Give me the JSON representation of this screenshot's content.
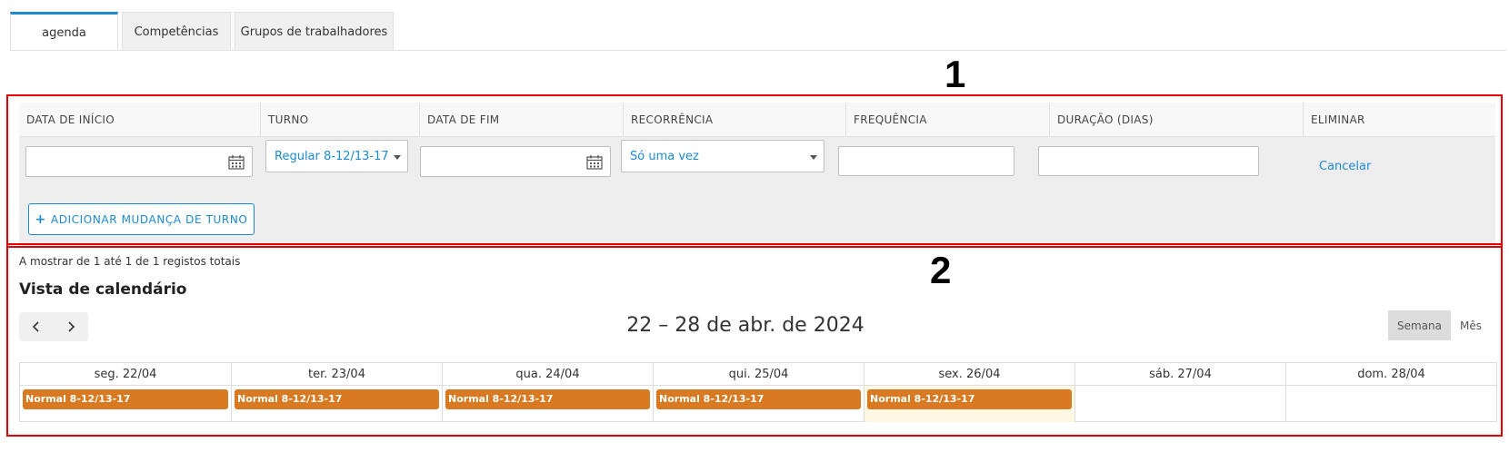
{
  "tabs": [
    {
      "label": "agenda"
    },
    {
      "label": "Competências"
    },
    {
      "label": "Grupos de trabalhadores"
    }
  ],
  "annotations": {
    "box1": "1",
    "box2": "2"
  },
  "shift_form": {
    "columns": [
      "DATA DE INÍCIO",
      "TURNO",
      "DATA DE FIM",
      "RECORRÊNCIA",
      "FREQUÊNCIA",
      "DURAÇÃO (DIAS)",
      "ELIMINAR"
    ],
    "start_date_value": "",
    "shift_selected": "Regular 8-12/13-17",
    "end_date_value": "",
    "recurrence_selected": "Só uma vez",
    "frequency_value": "",
    "duration_value": "",
    "cancel_label": "Cancelar",
    "add_button_label": "ADICIONAR MUDANÇA DE TURNO",
    "add_button_icon": "plus-icon"
  },
  "records_text": "A mostrar de 1 até 1 de 1 registos totais",
  "calendar": {
    "title": "Vista de calendário",
    "range": "22 – 28 de abr. de 2024",
    "view_week": "Semana",
    "view_month": "Mês",
    "active_view": "Semana",
    "days": [
      {
        "label": "seg. 22/04",
        "event": "Normal 8-12/13-17"
      },
      {
        "label": "ter. 23/04",
        "event": "Normal 8-12/13-17"
      },
      {
        "label": "qua. 24/04",
        "event": "Normal 8-12/13-17"
      },
      {
        "label": "qui. 25/04",
        "event": "Normal 8-12/13-17"
      },
      {
        "label": "sex. 26/04",
        "event": "Normal 8-12/13-17"
      },
      {
        "label": "sáb. 27/04",
        "event": ""
      },
      {
        "label": "dom. 28/04",
        "event": ""
      }
    ],
    "event_color": "#d97a22",
    "today_color": "#fcf8e3"
  },
  "colors": {
    "accent": "#1c8ad0",
    "annotation_border": "#e60000"
  }
}
